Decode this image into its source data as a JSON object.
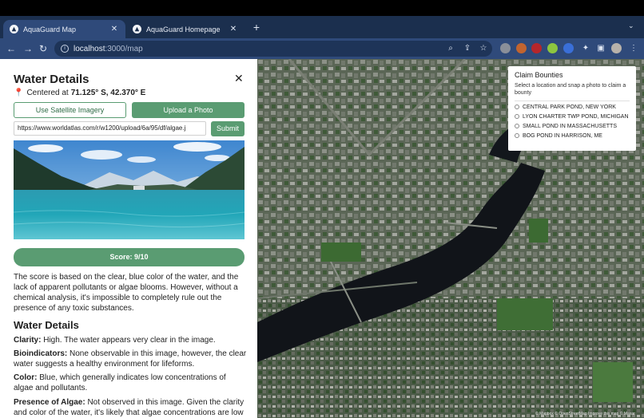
{
  "browser": {
    "tabs": [
      {
        "title": "AquaGuard Map",
        "active": true
      },
      {
        "title": "AquaGuard Homepage",
        "active": false
      }
    ],
    "new_tab_label": "+",
    "url_host": "localhost",
    "url_rest": ":3000/map",
    "colors": {
      "tabstrip": "#1b2f4e",
      "toolbar": "#2f4a7a"
    }
  },
  "panel": {
    "title": "Water Details",
    "coords_prefix": "Centered at",
    "coords_value": "71.125° S, 42.370° E",
    "satellite_button": "Use Satellite Imagery",
    "upload_button": "Upload a Photo",
    "image_url_value": "https://www.worldatlas.com/r/w1200/upload/6a/95/df/algae.j",
    "submit_button": "Submit",
    "score_label": "Score: 9/10",
    "score_fraction": 0.9,
    "score_explanation": "The score is based on the clear, blue color of the water, and the lack of apparent pollutants or algae blooms. However, without a chemical analysis, it's impossible to completely rule out the presence of any toxic substances.",
    "details_heading": "Water Details",
    "details": [
      {
        "label": "Clarity:",
        "text": "High. The water appears very clear in the image."
      },
      {
        "label": "Bioindicators:",
        "text": "None observable in this image, however, the clear water suggests a healthy environment for lifeforms."
      },
      {
        "label": "Color:",
        "text": "Blue, which generally indicates low concentrations of algae and pollutants."
      },
      {
        "label": "Presence of Algae:",
        "text": "Not observed in this image. Given the clarity and color of the water, it's likely that algae concentrations are low or"
      }
    ],
    "accent_color": "#5a9c72"
  },
  "bounties": {
    "title": "Claim Bounties",
    "subtitle": "Select a location and snap a photo to claim a bounty",
    "items": [
      "CENTRAL PARK POND, NEW YORK",
      "LYON CHARTER TWP POND, MICHIGAN",
      "SMALL POND IN MASSACHUSETTS",
      "BOG POND IN HARRISON, ME"
    ]
  },
  "map": {
    "attribution": "© Mapbox © OpenStreetMap Improve this map © Maxar"
  }
}
